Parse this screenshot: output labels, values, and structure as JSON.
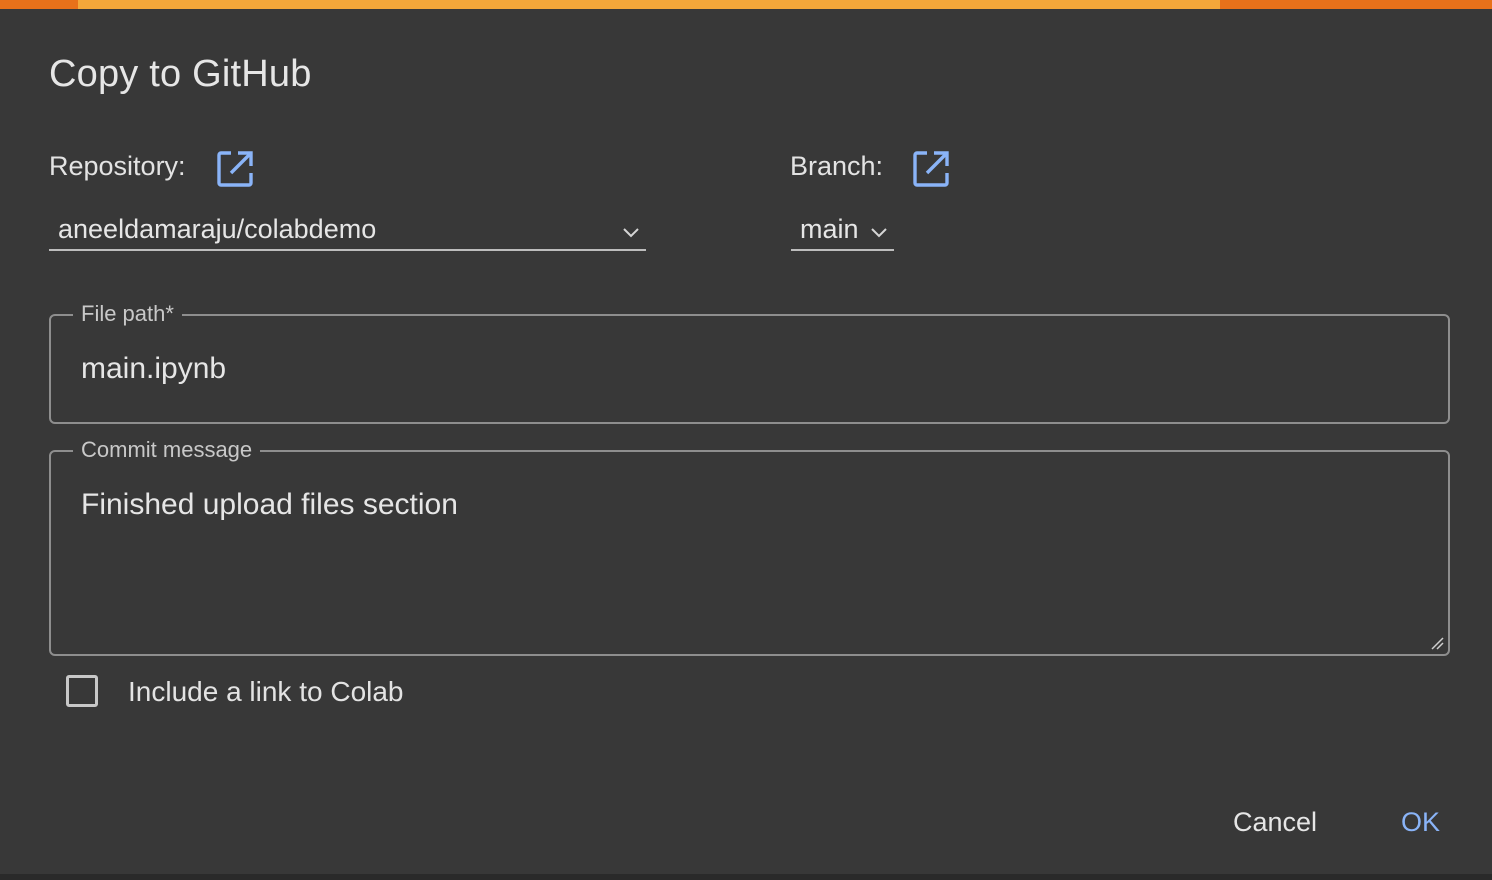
{
  "dialog": {
    "title": "Copy to GitHub"
  },
  "repository": {
    "label": "Repository:",
    "value": "aneeldamaraju/colabdemo",
    "open_icon": "open-in-new-icon"
  },
  "branch": {
    "label": "Branch:",
    "value": "main",
    "open_icon": "open-in-new-icon"
  },
  "file_path": {
    "label": "File path*",
    "value": "main.ipynb"
  },
  "commit_message": {
    "label": "Commit message",
    "value": "Finished upload files section"
  },
  "include_link": {
    "label": "Include a link to Colab",
    "checked": false
  },
  "actions": {
    "cancel_label": "Cancel",
    "ok_label": "OK"
  },
  "colors": {
    "background": "#383838",
    "accent_orange": "#e8711a",
    "accent_amber": "#f4a73a",
    "link_blue": "#8ab4f8",
    "text": "#e3e3e3"
  }
}
